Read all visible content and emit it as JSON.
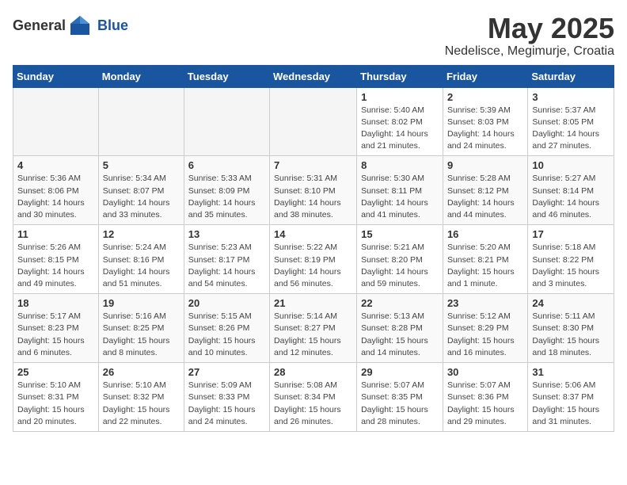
{
  "header": {
    "logo_general": "General",
    "logo_blue": "Blue",
    "month": "May 2025",
    "location": "Nedelisce, Megimurje, Croatia"
  },
  "weekdays": [
    "Sunday",
    "Monday",
    "Tuesday",
    "Wednesday",
    "Thursday",
    "Friday",
    "Saturday"
  ],
  "weeks": [
    [
      {
        "day": "",
        "empty": true
      },
      {
        "day": "",
        "empty": true
      },
      {
        "day": "",
        "empty": true
      },
      {
        "day": "",
        "empty": true
      },
      {
        "day": "1",
        "sunrise": "5:40 AM",
        "sunset": "8:02 PM",
        "daylight": "14 hours and 21 minutes."
      },
      {
        "day": "2",
        "sunrise": "5:39 AM",
        "sunset": "8:03 PM",
        "daylight": "14 hours and 24 minutes."
      },
      {
        "day": "3",
        "sunrise": "5:37 AM",
        "sunset": "8:05 PM",
        "daylight": "14 hours and 27 minutes."
      }
    ],
    [
      {
        "day": "4",
        "sunrise": "5:36 AM",
        "sunset": "8:06 PM",
        "daylight": "14 hours and 30 minutes."
      },
      {
        "day": "5",
        "sunrise": "5:34 AM",
        "sunset": "8:07 PM",
        "daylight": "14 hours and 33 minutes."
      },
      {
        "day": "6",
        "sunrise": "5:33 AM",
        "sunset": "8:09 PM",
        "daylight": "14 hours and 35 minutes."
      },
      {
        "day": "7",
        "sunrise": "5:31 AM",
        "sunset": "8:10 PM",
        "daylight": "14 hours and 38 minutes."
      },
      {
        "day": "8",
        "sunrise": "5:30 AM",
        "sunset": "8:11 PM",
        "daylight": "14 hours and 41 minutes."
      },
      {
        "day": "9",
        "sunrise": "5:28 AM",
        "sunset": "8:12 PM",
        "daylight": "14 hours and 44 minutes."
      },
      {
        "day": "10",
        "sunrise": "5:27 AM",
        "sunset": "8:14 PM",
        "daylight": "14 hours and 46 minutes."
      }
    ],
    [
      {
        "day": "11",
        "sunrise": "5:26 AM",
        "sunset": "8:15 PM",
        "daylight": "14 hours and 49 minutes."
      },
      {
        "day": "12",
        "sunrise": "5:24 AM",
        "sunset": "8:16 PM",
        "daylight": "14 hours and 51 minutes."
      },
      {
        "day": "13",
        "sunrise": "5:23 AM",
        "sunset": "8:17 PM",
        "daylight": "14 hours and 54 minutes."
      },
      {
        "day": "14",
        "sunrise": "5:22 AM",
        "sunset": "8:19 PM",
        "daylight": "14 hours and 56 minutes."
      },
      {
        "day": "15",
        "sunrise": "5:21 AM",
        "sunset": "8:20 PM",
        "daylight": "14 hours and 59 minutes."
      },
      {
        "day": "16",
        "sunrise": "5:20 AM",
        "sunset": "8:21 PM",
        "daylight": "15 hours and 1 minute."
      },
      {
        "day": "17",
        "sunrise": "5:18 AM",
        "sunset": "8:22 PM",
        "daylight": "15 hours and 3 minutes."
      }
    ],
    [
      {
        "day": "18",
        "sunrise": "5:17 AM",
        "sunset": "8:23 PM",
        "daylight": "15 hours and 6 minutes."
      },
      {
        "day": "19",
        "sunrise": "5:16 AM",
        "sunset": "8:25 PM",
        "daylight": "15 hours and 8 minutes."
      },
      {
        "day": "20",
        "sunrise": "5:15 AM",
        "sunset": "8:26 PM",
        "daylight": "15 hours and 10 minutes."
      },
      {
        "day": "21",
        "sunrise": "5:14 AM",
        "sunset": "8:27 PM",
        "daylight": "15 hours and 12 minutes."
      },
      {
        "day": "22",
        "sunrise": "5:13 AM",
        "sunset": "8:28 PM",
        "daylight": "15 hours and 14 minutes."
      },
      {
        "day": "23",
        "sunrise": "5:12 AM",
        "sunset": "8:29 PM",
        "daylight": "15 hours and 16 minutes."
      },
      {
        "day": "24",
        "sunrise": "5:11 AM",
        "sunset": "8:30 PM",
        "daylight": "15 hours and 18 minutes."
      }
    ],
    [
      {
        "day": "25",
        "sunrise": "5:10 AM",
        "sunset": "8:31 PM",
        "daylight": "15 hours and 20 minutes."
      },
      {
        "day": "26",
        "sunrise": "5:10 AM",
        "sunset": "8:32 PM",
        "daylight": "15 hours and 22 minutes."
      },
      {
        "day": "27",
        "sunrise": "5:09 AM",
        "sunset": "8:33 PM",
        "daylight": "15 hours and 24 minutes."
      },
      {
        "day": "28",
        "sunrise": "5:08 AM",
        "sunset": "8:34 PM",
        "daylight": "15 hours and 26 minutes."
      },
      {
        "day": "29",
        "sunrise": "5:07 AM",
        "sunset": "8:35 PM",
        "daylight": "15 hours and 28 minutes."
      },
      {
        "day": "30",
        "sunrise": "5:07 AM",
        "sunset": "8:36 PM",
        "daylight": "15 hours and 29 minutes."
      },
      {
        "day": "31",
        "sunrise": "5:06 AM",
        "sunset": "8:37 PM",
        "daylight": "15 hours and 31 minutes."
      }
    ]
  ]
}
